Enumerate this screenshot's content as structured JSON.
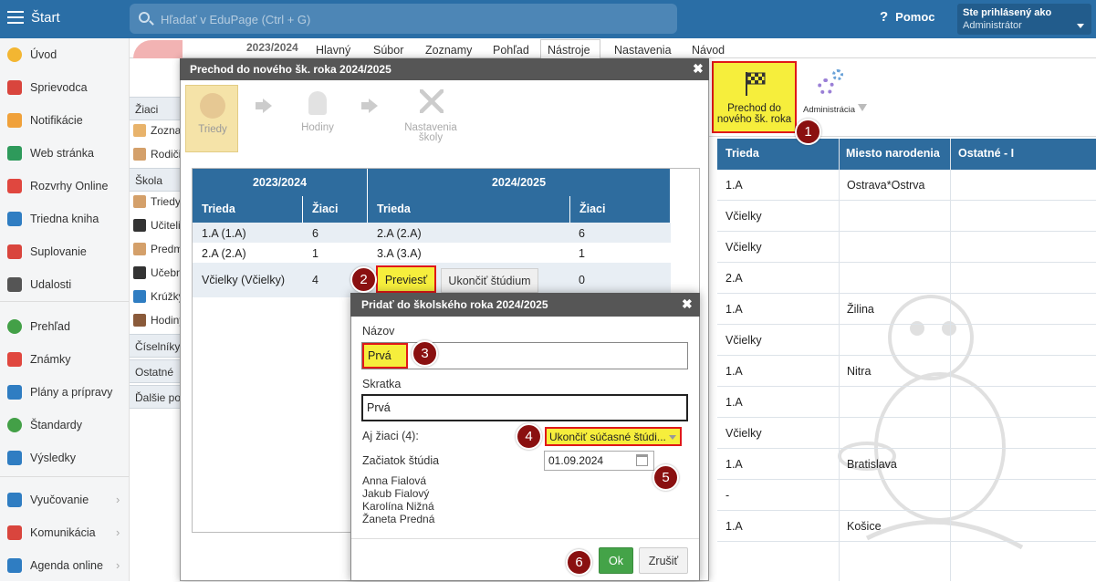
{
  "topbar": {
    "start_label": "Štart",
    "search_placeholder": "Hľadať v EduPage (Ctrl + G)",
    "help_label": "Pomoc",
    "help_glyph": "?",
    "user_line1": "Ste prihlásený ako",
    "user_line2": "Administrátor"
  },
  "sidebar": {
    "items": [
      {
        "label": "Úvod",
        "icon": "star-icon",
        "color": "#f3b632"
      },
      {
        "label": "Sprievodca",
        "icon": "magic-wand-icon",
        "color": "#d9453d"
      },
      {
        "label": "Notifikácie",
        "icon": "envelope-icon",
        "color": "#f0a13a"
      },
      {
        "label": "Web stránka",
        "icon": "home-icon",
        "color": "#2e9a5b"
      },
      {
        "label": "Rozvrhy Online",
        "icon": "timetable-icon",
        "color": "#e0473f"
      },
      {
        "label": "Triedna kniha",
        "icon": "book-icon",
        "color": "#2f7dc2"
      },
      {
        "label": "Suplovanie",
        "icon": "user-swap-icon",
        "color": "#d9453d"
      },
      {
        "label": "Udalosti",
        "icon": "calendar-icon",
        "color": "#555555"
      },
      {
        "label": "Prehľad",
        "icon": "check-circle-icon",
        "color": "#43a047"
      },
      {
        "label": "Známky",
        "icon": "grades-icon",
        "color": "#e0473f"
      },
      {
        "label": "Plány a prípravy",
        "icon": "briefcase-icon",
        "color": "#2f7dc2"
      },
      {
        "label": "Štandardy",
        "icon": "shield-check-icon",
        "color": "#43a047"
      },
      {
        "label": "Výsledky",
        "icon": "bar-chart-icon",
        "color": "#2f7dc2"
      },
      {
        "label": "Vyučovanie",
        "icon": "open-book-icon",
        "color": "#2f7dc2"
      },
      {
        "label": "Komunikácia",
        "icon": "chat-icon",
        "color": "#d9453d"
      },
      {
        "label": "Agenda online",
        "icon": "pencil-icon",
        "color": "#2f7dc2"
      }
    ]
  },
  "ribbon": {
    "year": "2023/2024",
    "tabs": [
      "Hlavný",
      "Súbor",
      "Zoznamy",
      "Pohľad",
      "Nástroje",
      "Nastavenia",
      "Návod"
    ],
    "prechod_label": "Prechod do nového šk. roka",
    "admin_label": "Administrácia"
  },
  "leftnav": {
    "rows": [
      {
        "label": "Žiaci",
        "head": true
      },
      {
        "label": "Zoznam",
        "head": false
      },
      {
        "label": "Rodičia",
        "head": false
      },
      {
        "label": "Škola",
        "head": true
      },
      {
        "label": "Triedy",
        "head": false
      },
      {
        "label": "Učitelia",
        "head": false
      },
      {
        "label": "Predmety",
        "head": false
      },
      {
        "label": "Učebne",
        "head": false
      },
      {
        "label": "Krúžky",
        "head": false
      },
      {
        "label": "Hodiny",
        "head": false
      },
      {
        "label": "Číselníky",
        "head": true
      },
      {
        "label": "Ostatné",
        "head": true
      },
      {
        "label": "Ďalšie po",
        "head": true
      }
    ]
  },
  "bgtable": {
    "headers": [
      "Trieda",
      "Miesto narodenia",
      "Ostatné - I"
    ],
    "rows": [
      [
        "1.A",
        "Ostrava*Ostrva"
      ],
      [
        "Včielky",
        ""
      ],
      [
        "Včielky",
        ""
      ],
      [
        "2.A",
        ""
      ],
      [
        "1.A",
        "Žilina"
      ],
      [
        "Včielky",
        ""
      ],
      [
        "1.A",
        "Nitra"
      ],
      [
        "1.A",
        ""
      ],
      [
        "Včielky",
        ""
      ],
      [
        "1.A",
        "Bratislava"
      ],
      [
        "-",
        ""
      ],
      [
        "1.A",
        "Košice"
      ]
    ]
  },
  "wizard": {
    "title": "Prechod do nového šk. roka 2024/2025",
    "steps": [
      "Triedy",
      "Hodiny",
      "Nastavenia školy"
    ],
    "year_old": "2023/2024",
    "year_new": "2024/2025",
    "col_trieda": "Trieda",
    "col_ziaci": "Žiaci",
    "rows": [
      {
        "trieda": "1.A (1.A)",
        "ziaci": "6",
        "new_trieda": "2.A (2.A)",
        "new_ziaci": "6"
      },
      {
        "trieda": "2.A (2.A)",
        "ziaci": "1",
        "new_trieda": "3.A (3.A)",
        "new_ziaci": "1"
      },
      {
        "trieda": "Včielky (Včielky)",
        "ziaci": "4",
        "new_trieda": "",
        "new_ziaci": "0"
      }
    ],
    "previest_label": "Previesť",
    "ukoncit_label": "Ukončiť štúdium"
  },
  "dialog": {
    "title": "Pridať do školského roka 2024/2025",
    "nazov_label": "Názov",
    "nazov_value": "Prvá",
    "skratka_label": "Skratka",
    "skratka_value": "Prvá",
    "ziaci_label": "Aj žiaci (4):",
    "ziaci_select": "Ukončiť súčasné štúdi...",
    "zaciatok_label": "Začiatok štúdia",
    "zaciatok_value": "01.09.2024",
    "names": [
      "Anna Fialová",
      "Jakub Fialový",
      "Karolína Nižná",
      "Žaneta Predná"
    ],
    "ok_label": "Ok",
    "cancel_label": "Zrušiť"
  },
  "markers": [
    "1",
    "2",
    "3",
    "4",
    "5",
    "6"
  ],
  "colors": {
    "accent": "#2a6ea6",
    "highlight": "#f6ee3c",
    "marker": "#8a1010",
    "ok": "#44a348"
  }
}
